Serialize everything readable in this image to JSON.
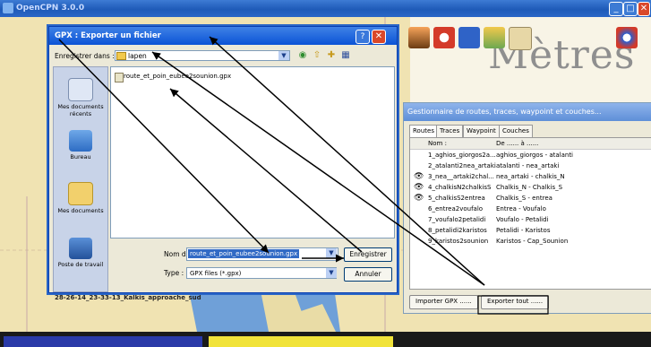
{
  "app": {
    "title": "OpenCPN 3.0.0",
    "controls": [
      "_",
      "□",
      "✕"
    ]
  },
  "chart": {
    "units_label": "Mètres",
    "track_label": "28-26-14_23-33-13_Kalkis_approache_sud"
  },
  "toolbar": {
    "icons": [
      "chart-icon",
      "settings-icon",
      "book-icon",
      "route-icon",
      "screenshot-icon",
      "compass-icon"
    ]
  },
  "dialog": {
    "title": "GPX : Exporter un fichier",
    "help": "?",
    "close": "✕",
    "save_in_label": "Enregistrer dans :",
    "save_in_value": "lapen",
    "places": [
      "Mes documents récents",
      "Bureau",
      "Mes documents",
      "Poste de travail"
    ],
    "files": [
      "route_et_poin_eubee2sounion.gpx"
    ],
    "filename_label": "Nom du fichier :",
    "filename_value": "route_et_poin_eubee2sounion.gpx",
    "type_label": "Type :",
    "type_value": "GPX files (*.gpx)",
    "save_button": "Enregistrer",
    "cancel_button": "Annuler"
  },
  "route_manager": {
    "title": "Gestionnaire de routes, traces, waypoint et couches...",
    "tabs": [
      "Routes",
      "Traces",
      "Waypoint",
      "Couches"
    ],
    "columns": [
      "Nom :",
      "De ...... à ......"
    ],
    "rows": [
      {
        "name": "1_aghios_giorgos2a...",
        "route": "aghios_giorgos - atalanti",
        "visible": false
      },
      {
        "name": "2_atalanti2nea_artaki",
        "route": "atalanti - nea_artaki",
        "visible": false
      },
      {
        "name": "3_nea__artaki2chal...",
        "route": "nea_artaki - chalkis_N",
        "visible": true
      },
      {
        "name": "4_chalkisN2chalkisS",
        "route": "Chalkis_N - Chalkis_S",
        "visible": true
      },
      {
        "name": "5_chalkisS2entrea",
        "route": "Chalkis_S - entrea",
        "visible": true
      },
      {
        "name": "6_entrea2voufalo",
        "route": "Entrea - Voufalo",
        "visible": false
      },
      {
        "name": "7_voufalo2petalidi",
        "route": "Voufalo - Petalidi",
        "visible": false
      },
      {
        "name": "8_petalidi2karistos",
        "route": "Petalidi - Karistos",
        "visible": false
      },
      {
        "name": "9_karistos2sounion",
        "route": "Karistos - Cap_Sounion",
        "visible": false
      }
    ],
    "import_button": "Importer GPX ......",
    "export_button": "Exporter tout ......"
  }
}
